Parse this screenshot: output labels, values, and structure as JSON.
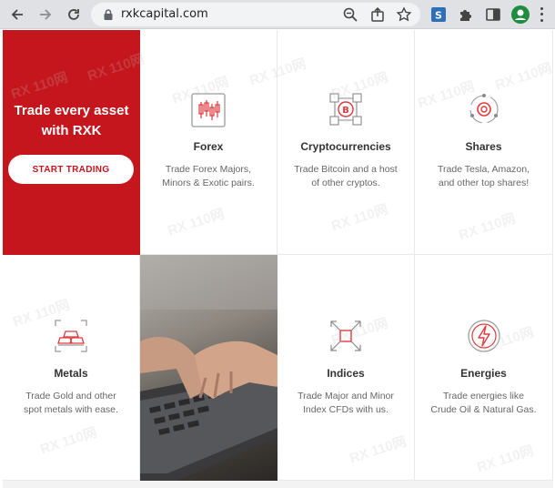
{
  "browser": {
    "url": "rxkcapital.com"
  },
  "hero": {
    "title_line1": "Trade every asset",
    "title_line2": "with RXK",
    "cta_label": "START TRADING",
    "background_color": "#c4161c"
  },
  "cards": {
    "forex": {
      "title": "Forex",
      "desc1": "Trade Forex Majors,",
      "desc2": "Minors & Exotic pairs.",
      "icon": "candlestick-chart-icon"
    },
    "crypto": {
      "title": "Cryptocurrencies",
      "desc1": "Trade Bitcoin and a host",
      "desc2": "of other cryptos.",
      "icon": "bitcoin-cube-icon"
    },
    "shares": {
      "title": "Shares",
      "desc1": "Trade Tesla, Amazon,",
      "desc2": "and other top shares!",
      "icon": "shares-orbit-icon"
    },
    "metals": {
      "title": "Metals",
      "desc1": "Trade Gold and other",
      "desc2": "spot metals with ease.",
      "icon": "gold-bars-icon"
    },
    "indices": {
      "title": "Indices",
      "desc1": "Trade Major and Minor",
      "desc2": "Index CFDs with us.",
      "icon": "indices-arrows-icon"
    },
    "energies": {
      "title": "Energies",
      "desc1": "Trade energies like",
      "desc2": "Crude Oil & Natural Gas.",
      "icon": "lightning-energy-icon"
    }
  },
  "watermark_text": "RX 110网",
  "accent_color": "#c4161c"
}
